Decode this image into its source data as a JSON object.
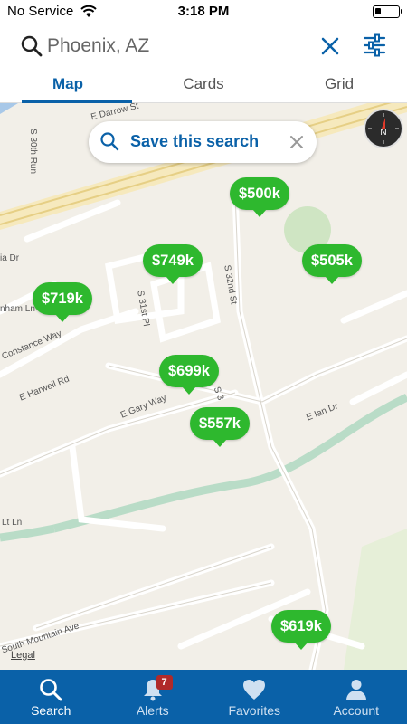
{
  "status_bar": {
    "carrier": "No Service",
    "time": "3:18 PM"
  },
  "search": {
    "query": "Phoenix, AZ"
  },
  "tabs": [
    {
      "label": "Map",
      "active": true
    },
    {
      "label": "Cards",
      "active": false
    },
    {
      "label": "Grid",
      "active": false
    }
  ],
  "map": {
    "save_search_label": "Save this search",
    "legal_label": "Legal",
    "streets": [
      "E Darrow St",
      "S 30th Run",
      "S 32nd St",
      "S 31st Pl",
      "Constance Way",
      "E Harwell Rd",
      "E Gary Way",
      "E Ian Dr",
      "South Mountain Ave",
      "Lt Ln",
      "nham Ln",
      "ia Dr",
      "S 3"
    ],
    "price_pins": [
      {
        "price": "$500k"
      },
      {
        "price": "$749k"
      },
      {
        "price": "$505k"
      },
      {
        "price": "$719k"
      },
      {
        "price": "$699k"
      },
      {
        "price": "$557k"
      },
      {
        "price": "$619k"
      }
    ]
  },
  "bottom_tabs": [
    {
      "label": "Search",
      "icon": "search-icon",
      "active": true
    },
    {
      "label": "Alerts",
      "icon": "bell-icon",
      "active": false,
      "badge": "7"
    },
    {
      "label": "Favorites",
      "icon": "heart-icon",
      "active": false
    },
    {
      "label": "Account",
      "icon": "person-icon",
      "active": false
    }
  ],
  "colors": {
    "brand_blue": "#0a61a8",
    "pin_green": "#2eb82e",
    "map_background": "#f2efe8",
    "badge_red": "#b02a2a"
  }
}
